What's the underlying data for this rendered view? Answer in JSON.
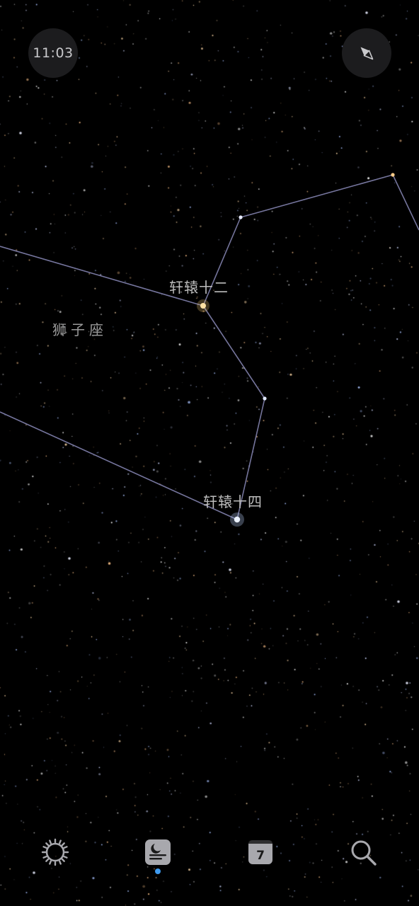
{
  "status": {
    "time": "11:03"
  },
  "sky": {
    "constellation_label": "狮子座",
    "star_labels": {
      "star_a": "轩辕十二",
      "star_b": "轩辕十四"
    },
    "line_color": "#8a8ab8"
  },
  "tabs": [
    {
      "icon": "sun-icon",
      "active": false
    },
    {
      "icon": "tonight-icon",
      "active": true
    },
    {
      "icon": "calendar-icon",
      "active": false,
      "day": "7"
    },
    {
      "icon": "search-icon",
      "active": false
    }
  ],
  "colors": {
    "accent": "#3f9bf0",
    "button_bg": "#1c1c1e",
    "icon_gray": "#a8a8ad"
  }
}
